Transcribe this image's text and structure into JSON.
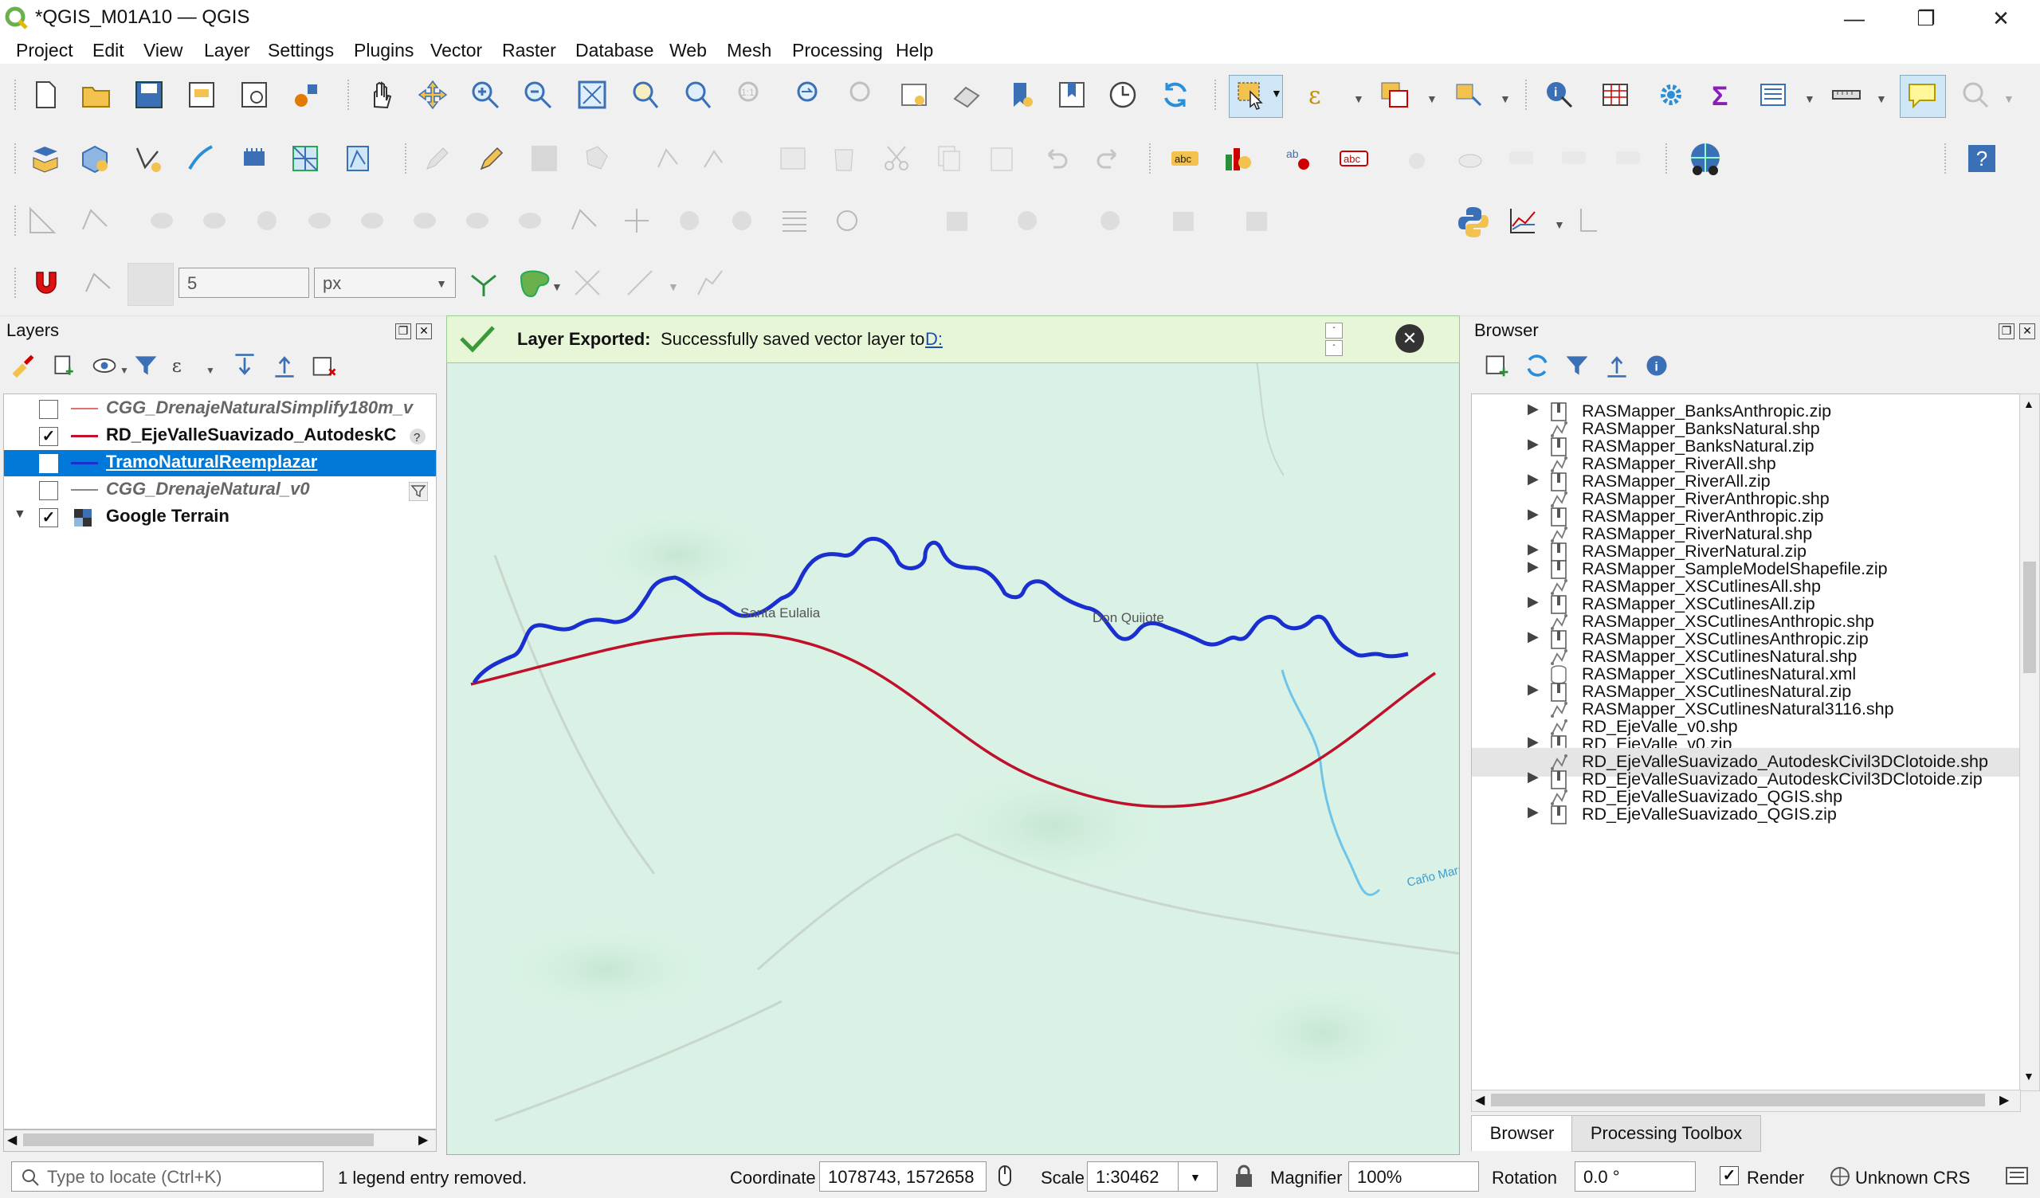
{
  "window": {
    "title": "*QGIS_M01A10 — QGIS",
    "minimize": "—",
    "maximize": "❐",
    "close": "✕"
  },
  "menu": [
    "Project",
    "Edit",
    "View",
    "Layer",
    "Settings",
    "Plugins",
    "Vector",
    "Raster",
    "Database",
    "Web",
    "Mesh",
    "Processing",
    "Help"
  ],
  "snapping": {
    "tolerance": "5",
    "unit": "px"
  },
  "layers_panel": {
    "title": "Layers",
    "items": [
      {
        "name": "CGG_DrenajeNaturalSimplify180m_v",
        "checked": false,
        "line_color": "#e07070"
      },
      {
        "name": "RD_EjeValleSuavizado_AutodeskC",
        "checked": true,
        "line_color": "#c0102a"
      },
      {
        "name": "TramoNaturalReemplazar",
        "checked": true,
        "line_color": "#1a2fd0"
      },
      {
        "name": "CGG_DrenajeNatural_v0",
        "checked": false,
        "line_color": "#888888"
      },
      {
        "name": "Google Terrain",
        "checked": true
      }
    ]
  },
  "message_bar": {
    "bold": "Layer Exported:",
    "text": "Successfully saved vector layer to",
    "link": "D:"
  },
  "map_labels": {
    "town1": "Santa Eulalia",
    "town2": "Don Quijote",
    "river": "Caño Mara"
  },
  "browser_panel": {
    "title": "Browser",
    "items": [
      {
        "label": "RASMapper_BanksAnthropic.zip",
        "type": "zip"
      },
      {
        "label": "RASMapper_BanksNatural.shp",
        "type": "shp"
      },
      {
        "label": "RASMapper_BanksNatural.zip",
        "type": "zip"
      },
      {
        "label": "RASMapper_RiverAll.shp",
        "type": "shp"
      },
      {
        "label": "RASMapper_RiverAll.zip",
        "type": "zip"
      },
      {
        "label": "RASMapper_RiverAnthropic.shp",
        "type": "shp"
      },
      {
        "label": "RASMapper_RiverAnthropic.zip",
        "type": "zip"
      },
      {
        "label": "RASMapper_RiverNatural.shp",
        "type": "shp"
      },
      {
        "label": "RASMapper_RiverNatural.zip",
        "type": "zip"
      },
      {
        "label": "RASMapper_SampleModelShapefile.zip",
        "type": "zip"
      },
      {
        "label": "RASMapper_XSCutlinesAll.shp",
        "type": "shp"
      },
      {
        "label": "RASMapper_XSCutlinesAll.zip",
        "type": "zip"
      },
      {
        "label": "RASMapper_XSCutlinesAnthropic.shp",
        "type": "shp"
      },
      {
        "label": "RASMapper_XSCutlinesAnthropic.zip",
        "type": "zip"
      },
      {
        "label": "RASMapper_XSCutlinesNatural.shp",
        "type": "shp"
      },
      {
        "label": "RASMapper_XSCutlinesNatural.xml",
        "type": "xml"
      },
      {
        "label": "RASMapper_XSCutlinesNatural.zip",
        "type": "zip"
      },
      {
        "label": "RASMapper_XSCutlinesNatural3116.shp",
        "type": "shp"
      },
      {
        "label": "RD_EjeValle_v0.shp",
        "type": "shp"
      },
      {
        "label": "RD_EjeValle_v0.zip",
        "type": "zip"
      },
      {
        "label": "RD_EjeValleSuavizado_AutodeskCivil3DClotoide.shp",
        "type": "shp",
        "selected": true
      },
      {
        "label": "RD_EjeValleSuavizado_AutodeskCivil3DClotoide.zip",
        "type": "zip"
      },
      {
        "label": "RD_EjeValleSuavizado_QGIS.shp",
        "type": "shp"
      },
      {
        "label": "RD_EjeValleSuavizado_QGIS.zip",
        "type": "zip"
      }
    ],
    "tabs": [
      "Browser",
      "Processing Toolbox"
    ]
  },
  "status_bar": {
    "locate_placeholder": "Type to locate (Ctrl+K)",
    "message": "1 legend entry removed.",
    "coordinate_label": "Coordinate",
    "coordinate": "1078743, 1572658",
    "scale_label": "Scale",
    "scale": "1:30462",
    "magnifier_label": "Magnifier",
    "magnifier": "100%",
    "rotation_label": "Rotation",
    "rotation": "0.0 °",
    "render_label": "Render",
    "crs": "Unknown CRS"
  },
  "colors": {
    "selection": "#0078d7",
    "map_bg": "#d9f2e5",
    "river_blue": "#1a2fd0",
    "axis_red": "#c0102a"
  }
}
